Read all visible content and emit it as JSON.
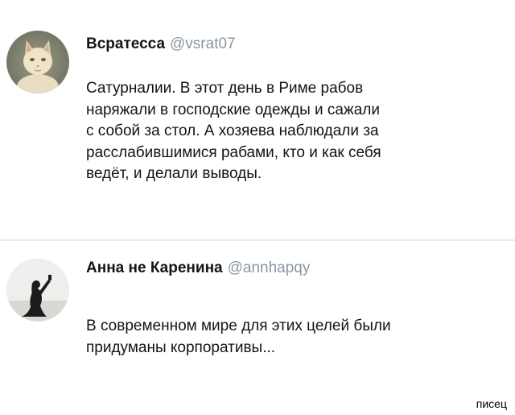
{
  "tweets": [
    {
      "display_name": "Всратесса",
      "handle": "@vsrat07",
      "avatar_icon": "cat-avatar-icon",
      "text_lines": [
        "Сатурналии. В этот день в Риме рабов",
        "наряжали в господские одежды и сажали",
        "с собой за стол. А хозяева наблюдали за",
        "расслабившимися рабами, кто и как себя",
        "ведёт, и делали выводы."
      ]
    },
    {
      "display_name": "Анна не Каренина",
      "handle": "@annhapqy",
      "avatar_icon": "woman-silhouette-avatar-icon",
      "text_lines": [
        "В современном мире для этих целей были",
        "придуманы корпоративы..."
      ]
    }
  ],
  "watermark": "писец",
  "colors": {
    "text": "#141414",
    "handle": "#8a96a0",
    "divider": "#e6ecf0",
    "background": "#ffffff"
  }
}
